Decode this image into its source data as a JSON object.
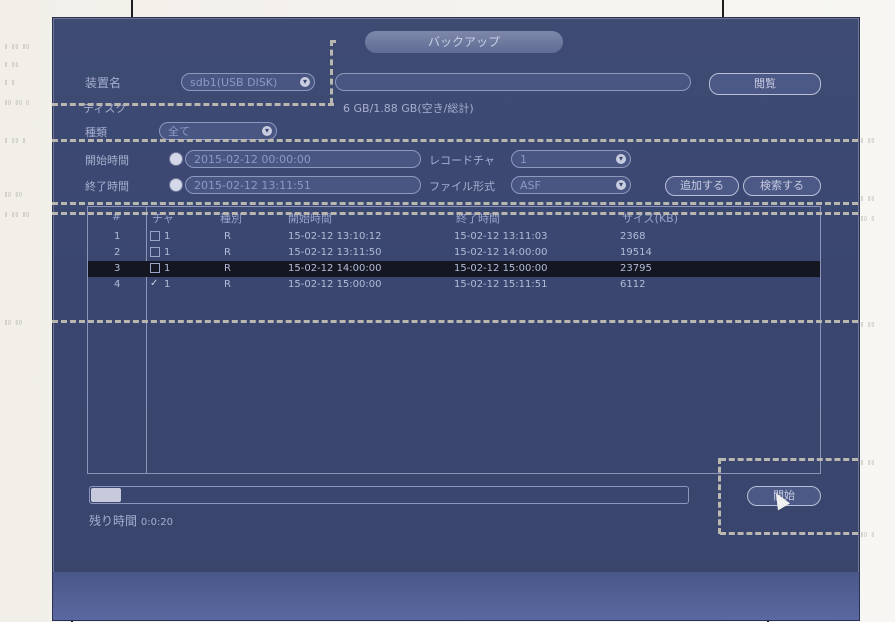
{
  "window": {
    "title": "バックアップ"
  },
  "device": {
    "label": "装置名",
    "selected": "sdb1(USB DISK)",
    "browse_label": "閲覧",
    "storage_text": "6 GB/1.88 GB(空き/総計)",
    "storage_prefix": "ディスク"
  },
  "form": {
    "type_label": "種類",
    "type_value": "全て",
    "start_label": "開始時間",
    "start_value": "2015-02-12 00:00:00",
    "end_label": "終了時間",
    "end_value": "2015-02-12 13:11:51",
    "recorder_label": "レコードチャ",
    "recorder_value": "1",
    "file_format_label": "ファイル形式",
    "file_format_value": "ASF",
    "add_label": "追加する",
    "delete_label": "検索する"
  },
  "table": {
    "headers": [
      "#",
      "チャ",
      "種別",
      "開始時間",
      "終了時間",
      "サイズ(KB)"
    ],
    "rows": [
      {
        "num": "1",
        "checked": false,
        "ch": "1",
        "type": "R",
        "start": "15-02-12 13:10:12",
        "end": "15-02-12 13:11:03",
        "size": "2368",
        "selected": false
      },
      {
        "num": "2",
        "checked": false,
        "ch": "1",
        "type": "R",
        "start": "15-02-12 13:11:50",
        "end": "15-02-12 14:00:00",
        "size": "19514",
        "selected": false
      },
      {
        "num": "3",
        "checked": false,
        "ch": "1",
        "type": "R",
        "start": "15-02-12 14:00:00",
        "end": "15-02-12 15:00:00",
        "size": "23795",
        "selected": true
      },
      {
        "num": "4",
        "checked": true,
        "ch": "1",
        "type": "R",
        "start": "15-02-12 15:00:00",
        "end": "15-02-12 15:11:51",
        "size": "6112",
        "selected": false
      }
    ]
  },
  "progress": {
    "fraction": 0.05,
    "remaining_label": "残り時間",
    "remaining_value": "0:0:20"
  },
  "actions": {
    "backup_label": "開始"
  },
  "colors": {
    "panel": "#3b4670",
    "dashes": "#b8b8b0",
    "selected_row": "#141722"
  },
  "icons": {
    "clock": "clock-icon",
    "chevron": "chevron-down-icon"
  }
}
